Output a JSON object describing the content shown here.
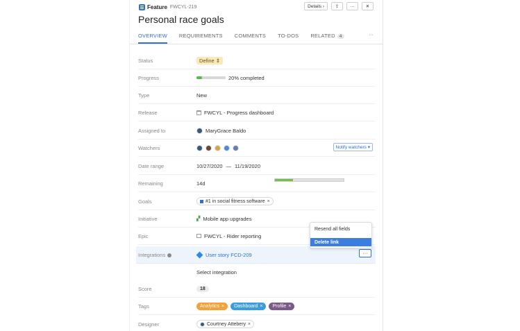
{
  "header": {
    "type_label": "Feature",
    "ref": "FWCYL-219",
    "details_btn": "Details ›",
    "title": "Personal race goals"
  },
  "tabs": [
    {
      "label": "OVERVIEW",
      "active": true
    },
    {
      "label": "REQUIREMENTS"
    },
    {
      "label": "COMMENTS"
    },
    {
      "label": "TO-DOS"
    },
    {
      "label": "RELATED",
      "count": "4"
    }
  ],
  "tabs_more": "···",
  "fields": {
    "status": {
      "label": "Status",
      "value": "Define ⇕"
    },
    "progress": {
      "label": "Progress",
      "text": "20% completed",
      "fraction": 0.2
    },
    "type": {
      "label": "Type",
      "value": "New"
    },
    "release": {
      "label": "Release",
      "value": "FWCYL - Progress dashboard"
    },
    "assigned": {
      "label": "Assigned to",
      "value": "MaryGrace Baldo"
    },
    "watchers": {
      "label": "Watchers",
      "count": 5,
      "notify_btn": "Notify watchers ▾"
    },
    "date_range": {
      "label": "Date range",
      "start": "10/27/2020",
      "sep": "—",
      "end": "11/19/2020"
    },
    "remaining": {
      "label": "Remaining",
      "value": "14d",
      "fraction": 0.26
    },
    "goals": {
      "label": "Goals",
      "chip": "#1 in social fitness software",
      "x": "×"
    },
    "initiative": {
      "label": "Initiative",
      "value": "Mobile app upgrades"
    },
    "epic": {
      "label": "Epic",
      "value": "FWCYL - Rider reporting"
    },
    "integrations": {
      "label": "Integrations",
      "link": "User story FCD-209",
      "more": "···"
    },
    "select_integration": {
      "placeholder": "Select integration"
    },
    "score": {
      "label": "Score",
      "value": "18"
    },
    "tags": {
      "label": "Tags",
      "items": [
        {
          "name": "Analytics",
          "color": "#f2a23a"
        },
        {
          "name": "Dashboard",
          "color": "#3d9ce0"
        },
        {
          "name": "Profile",
          "color": "#7a5a86"
        }
      ],
      "x": "×"
    },
    "designer": {
      "label": "Designer",
      "value": "Courtney Attebery",
      "x": "×"
    }
  },
  "menu": {
    "items": [
      "Resend all fields",
      "Delete link"
    ],
    "selected": "Delete link"
  },
  "colors": {
    "accent": "#2f6fd1",
    "define_bg": "#fbe9b9",
    "progress": "#58b94a"
  }
}
